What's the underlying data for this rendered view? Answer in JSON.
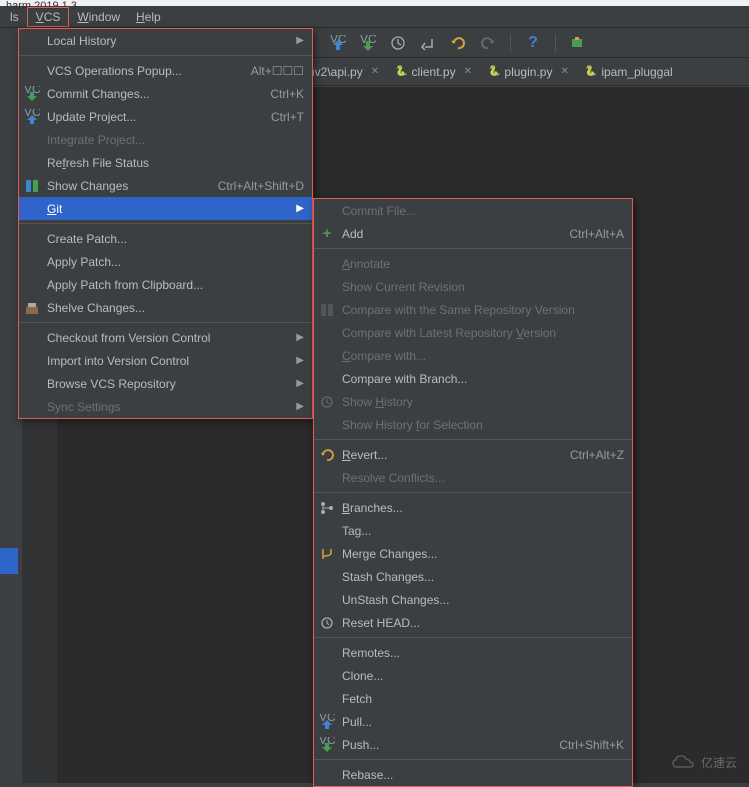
{
  "title": "harm 2019.1.3",
  "menubar": {
    "ls": "ls",
    "vcs": "VCS",
    "window": "Window",
    "help": "Help"
  },
  "tabs": {
    "t0": {
      "name": "nv2\\api.py"
    },
    "t1": {
      "name": "client.py"
    },
    "t2": {
      "name": "plugin.py"
    },
    "t3": {
      "name": "ipam_pluggal"
    }
  },
  "vcs_menu": {
    "local_history": "Local History",
    "vcs_ops": "VCS Operations Popup...",
    "vcs_ops_sc": "Alt+☐☐☐",
    "commit": "Commit Changes...",
    "commit_sc": "Ctrl+K",
    "update": "Update Project...",
    "update_sc": "Ctrl+T",
    "integrate": "Integrate Project...",
    "refresh": "Refresh File Status",
    "show_changes": "Show Changes",
    "show_changes_sc": "Ctrl+Alt+Shift+D",
    "git": "Git",
    "create_patch": "Create Patch...",
    "apply_patch": "Apply Patch...",
    "apply_clip": "Apply Patch from Clipboard...",
    "shelve": "Shelve Changes...",
    "checkout": "Checkout from Version Control",
    "import": "Import into Version Control",
    "browse": "Browse VCS Repository",
    "sync": "Sync Settings"
  },
  "git_menu": {
    "commit_file": "Commit File...",
    "add": "Add",
    "add_sc": "Ctrl+Alt+A",
    "annotate": "Annotate",
    "show_cur": "Show Current Revision",
    "cmp_same": "Compare with the Same Repository Version",
    "cmp_latest": "Compare with Latest Repository Version",
    "cmp_with": "Compare with...",
    "cmp_branch": "Compare with Branch...",
    "show_hist": "Show History",
    "show_hist_sel": "Show History for Selection",
    "revert": "Revert...",
    "revert_sc": "Ctrl+Alt+Z",
    "resolve": "Resolve Conflicts...",
    "branches": "Branches...",
    "tag": "Tag...",
    "merge": "Merge Changes...",
    "stash": "Stash Changes...",
    "unstash": "UnStash Changes...",
    "reset": "Reset HEAD...",
    "remotes": "Remotes...",
    "clone": "Clone...",
    "fetch": "Fetch",
    "pull": "Pull...",
    "push": "Push...",
    "push_sc": "Ctrl+Shift+K",
    "rebase": "Rebase..."
  },
  "watermark": "亿速云"
}
